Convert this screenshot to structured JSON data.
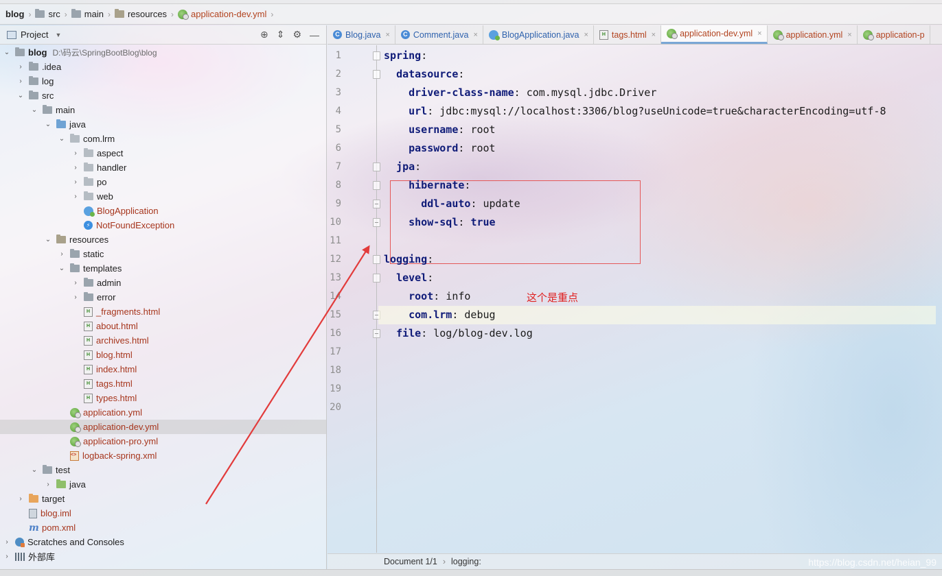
{
  "breadcrumb": {
    "items": [
      {
        "label": "blog",
        "icon": "folder-icon"
      },
      {
        "label": "src",
        "icon": "folder-icon"
      },
      {
        "label": "main",
        "icon": "folder-icon"
      },
      {
        "label": "resources",
        "icon": "resources-folder-icon"
      },
      {
        "label": "application-dev.yml",
        "icon": "yml-icon"
      }
    ]
  },
  "project_panel": {
    "title": "Project",
    "root_label": "blog",
    "root_path": "D:\\码云\\SpringBootBlog\\blog",
    "actions": [
      "locate-icon",
      "collapse-icon",
      "gear-icon",
      "minimize-icon"
    ],
    "tree": [
      {
        "label": ".idea",
        "depth": 1,
        "arrow": "›",
        "icon": "folder"
      },
      {
        "label": "log",
        "depth": 1,
        "arrow": "›",
        "icon": "folder"
      },
      {
        "label": "src",
        "depth": 1,
        "arrow": "⌄",
        "icon": "folder"
      },
      {
        "label": "main",
        "depth": 2,
        "arrow": "⌄",
        "icon": "folder"
      },
      {
        "label": "java",
        "depth": 3,
        "arrow": "⌄",
        "icon": "folder-blue"
      },
      {
        "label": "com.lrm",
        "depth": 4,
        "arrow": "⌄",
        "icon": "package"
      },
      {
        "label": "aspect",
        "depth": 5,
        "arrow": "›",
        "icon": "package"
      },
      {
        "label": "handler",
        "depth": 5,
        "arrow": "›",
        "icon": "package"
      },
      {
        "label": "po",
        "depth": 5,
        "arrow": "›",
        "icon": "package"
      },
      {
        "label": "web",
        "depth": 5,
        "arrow": "›",
        "icon": "package"
      },
      {
        "label": "BlogApplication",
        "depth": 5,
        "arrow": "",
        "icon": "spring",
        "red": true
      },
      {
        "label": "NotFoundException",
        "depth": 5,
        "arrow": "",
        "icon": "exception",
        "red": true
      },
      {
        "label": "resources",
        "depth": 3,
        "arrow": "⌄",
        "icon": "folder-res"
      },
      {
        "label": "static",
        "depth": 4,
        "arrow": "›",
        "icon": "folder"
      },
      {
        "label": "templates",
        "depth": 4,
        "arrow": "⌄",
        "icon": "folder"
      },
      {
        "label": "admin",
        "depth": 5,
        "arrow": "›",
        "icon": "folder"
      },
      {
        "label": "error",
        "depth": 5,
        "arrow": "›",
        "icon": "folder"
      },
      {
        "label": "_fragments.html",
        "depth": 5,
        "arrow": "",
        "icon": "html",
        "red": true
      },
      {
        "label": "about.html",
        "depth": 5,
        "arrow": "",
        "icon": "html",
        "red": true
      },
      {
        "label": "archives.html",
        "depth": 5,
        "arrow": "",
        "icon": "html",
        "red": true
      },
      {
        "label": "blog.html",
        "depth": 5,
        "arrow": "",
        "icon": "html",
        "red": true
      },
      {
        "label": "index.html",
        "depth": 5,
        "arrow": "",
        "icon": "html",
        "red": true
      },
      {
        "label": "tags.html",
        "depth": 5,
        "arrow": "",
        "icon": "html",
        "red": true
      },
      {
        "label": "types.html",
        "depth": 5,
        "arrow": "",
        "icon": "html",
        "red": true
      },
      {
        "label": "application.yml",
        "depth": 4,
        "arrow": "",
        "icon": "yml",
        "red": true
      },
      {
        "label": "application-dev.yml",
        "depth": 4,
        "arrow": "",
        "icon": "yml",
        "red": true,
        "selected": true
      },
      {
        "label": "application-pro.yml",
        "depth": 4,
        "arrow": "",
        "icon": "yml",
        "red": true
      },
      {
        "label": "logback-spring.xml",
        "depth": 4,
        "arrow": "",
        "icon": "xml",
        "red": true
      },
      {
        "label": "test",
        "depth": 2,
        "arrow": "⌄",
        "icon": "folder"
      },
      {
        "label": "java",
        "depth": 3,
        "arrow": "›",
        "icon": "folder-green"
      },
      {
        "label": "target",
        "depth": 1,
        "arrow": "›",
        "icon": "folder-orange"
      },
      {
        "label": "blog.iml",
        "depth": 1,
        "arrow": "",
        "icon": "iml",
        "red": true
      },
      {
        "label": "pom.xml",
        "depth": 1,
        "arrow": "",
        "icon": "maven",
        "red": true
      },
      {
        "label": "Scratches and Consoles",
        "depth": 0,
        "arrow": "›",
        "icon": "scratch"
      },
      {
        "label": "外部库",
        "depth": 0,
        "arrow": "›",
        "icon": "library"
      }
    ]
  },
  "editor": {
    "tabs": [
      {
        "label": "Blog.java",
        "icon": "java-class",
        "color": "blue"
      },
      {
        "label": "Comment.java",
        "icon": "java-class",
        "color": "blue"
      },
      {
        "label": "BlogApplication.java",
        "icon": "spring",
        "color": "blue"
      },
      {
        "label": "tags.html",
        "icon": "html",
        "color": "brown"
      },
      {
        "label": "application-dev.yml",
        "icon": "yml",
        "color": "brown",
        "active": true
      },
      {
        "label": "application.yml",
        "icon": "yml",
        "color": "brown"
      },
      {
        "label": "application-p",
        "icon": "yml",
        "color": "brown"
      }
    ],
    "lines": [
      {
        "n": "1",
        "indent": 0,
        "key": "spring",
        "value": ""
      },
      {
        "n": "2",
        "indent": 2,
        "key": "datasource",
        "value": ""
      },
      {
        "n": "3",
        "indent": 4,
        "key": "driver-class-name",
        "value": "com.mysql.jdbc.Driver"
      },
      {
        "n": "4",
        "indent": 4,
        "key": "url",
        "value": "jdbc:mysql://localhost:3306/blog?useUnicode=true&characterEncoding=utf-8"
      },
      {
        "n": "5",
        "indent": 4,
        "key": "username",
        "value": "root"
      },
      {
        "n": "6",
        "indent": 4,
        "key": "password",
        "value": "root"
      },
      {
        "n": "7",
        "indent": 2,
        "key": "jpa",
        "value": ""
      },
      {
        "n": "8",
        "indent": 4,
        "key": "hibernate",
        "value": ""
      },
      {
        "n": "9",
        "indent": 6,
        "key": "ddl-auto",
        "value": "update"
      },
      {
        "n": "10",
        "indent": 4,
        "key": "show-sql",
        "value": "true",
        "value_bold": true
      },
      {
        "n": "11",
        "indent": 0,
        "key": "",
        "value": ""
      },
      {
        "n": "12",
        "indent": 0,
        "key": "logging",
        "value": ""
      },
      {
        "n": "13",
        "indent": 2,
        "key": "level",
        "value": ""
      },
      {
        "n": "14",
        "indent": 4,
        "key": "root",
        "value": "info"
      },
      {
        "n": "15",
        "indent": 4,
        "key": "com.lrm",
        "value": "debug",
        "highlight": true
      },
      {
        "n": "16",
        "indent": 2,
        "key": "file",
        "value": "log/blog-dev.log"
      },
      {
        "n": "17",
        "indent": 0,
        "key": "",
        "value": ""
      },
      {
        "n": "18",
        "indent": 0,
        "key": "",
        "value": ""
      },
      {
        "n": "19",
        "indent": 0,
        "key": "",
        "value": ""
      },
      {
        "n": "20",
        "indent": 0,
        "key": "",
        "value": ""
      }
    ],
    "annotation": "这个是重点",
    "status": {
      "document": "Document 1/1",
      "context": "logging:"
    }
  },
  "watermark": "https://blog.csdn.net/heian_99",
  "colors": {
    "annotation_red": "#e02020",
    "yaml_key": "#0f1b78",
    "file_red": "#a6351c"
  }
}
